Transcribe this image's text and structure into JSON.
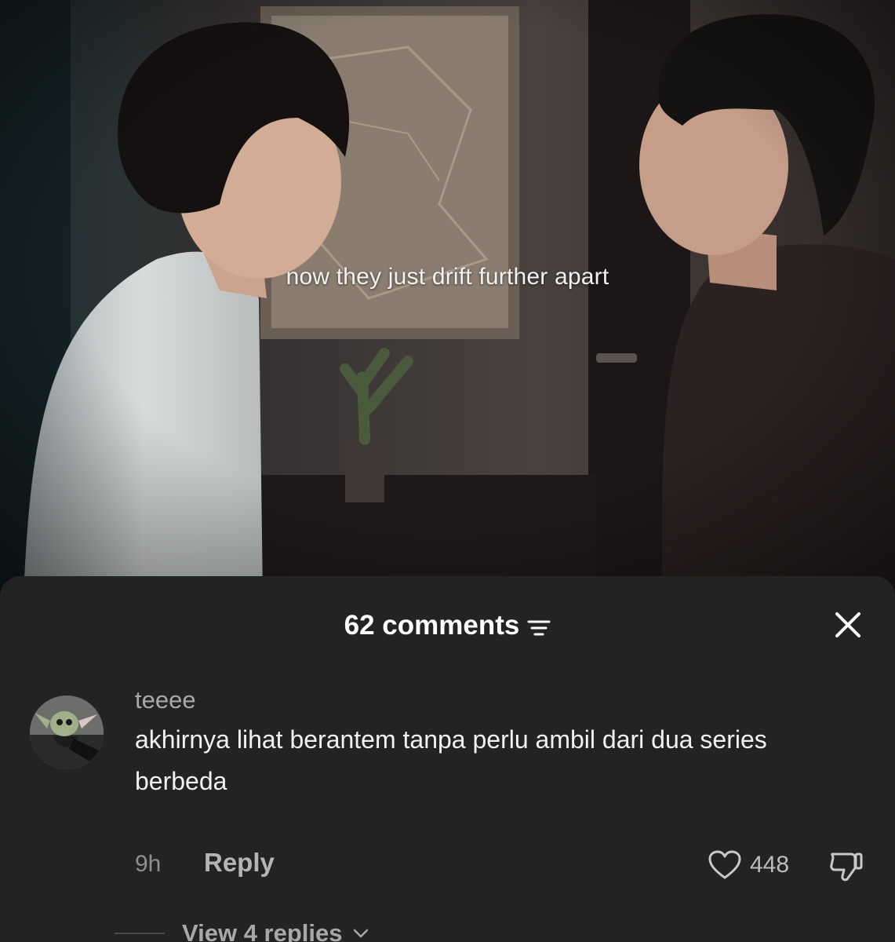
{
  "video": {
    "caption": "now they just drift further apart"
  },
  "comments_panel": {
    "count_label": "62 comments",
    "sort_icon": "filter-lines-icon",
    "close_icon": "close-icon"
  },
  "comment": {
    "username": "teeee",
    "text": "akhirnya lihat berantem tanpa perlu ambil dari dua series berbeda",
    "time": "9h",
    "reply_label": "Reply",
    "like_count": "448",
    "view_replies_label": "View 4 replies"
  },
  "colors": {
    "sheet_background": "#232323",
    "primary_text": "#ffffff",
    "secondary_text": "#a9a9a9"
  }
}
